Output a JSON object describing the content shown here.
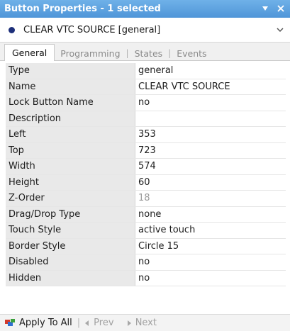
{
  "window": {
    "title": "Button Properties - 1 selected",
    "pin_icon": "pin-icon",
    "close_icon": "close-icon"
  },
  "selector": {
    "value": "CLEAR VTC SOURCE  [general]"
  },
  "tabs": [
    {
      "label": "General",
      "active": true
    },
    {
      "label": "Programming",
      "active": false
    },
    {
      "label": "States",
      "active": false
    },
    {
      "label": "Events",
      "active": false
    }
  ],
  "properties": [
    {
      "name": "Type",
      "value": "general"
    },
    {
      "name": "Name",
      "value": "CLEAR VTC SOURCE"
    },
    {
      "name": "Lock Button Name",
      "value": "no"
    },
    {
      "name": "Description",
      "value": ""
    },
    {
      "name": "Left",
      "value": "353"
    },
    {
      "name": "Top",
      "value": "723"
    },
    {
      "name": "Width",
      "value": "574"
    },
    {
      "name": "Height",
      "value": "60"
    },
    {
      "name": "Z-Order",
      "value": "18"
    },
    {
      "name": "Drag/Drop Type",
      "value": "none"
    },
    {
      "name": "Touch Style",
      "value": "active touch"
    },
    {
      "name": "Border Style",
      "value": "Circle 15"
    },
    {
      "name": "Disabled",
      "value": "no"
    },
    {
      "name": "Hidden",
      "value": "no"
    }
  ],
  "footer": {
    "apply_label": "Apply To All",
    "prev_label": "Prev",
    "next_label": "Next"
  },
  "colors": {
    "titlebar": "#5aa2e0",
    "selector_dot": "#1d2f7a"
  }
}
